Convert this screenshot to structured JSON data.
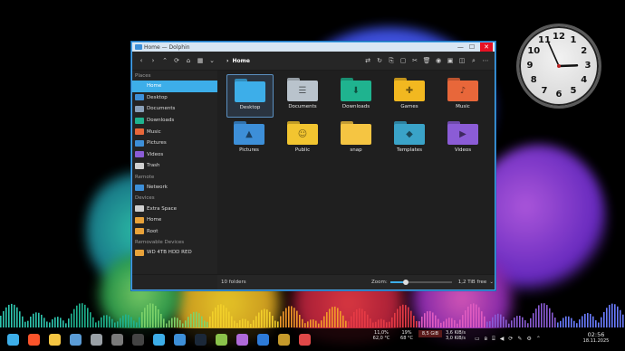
{
  "window": {
    "title": "Home — Dolphin",
    "breadcrumb": "Home",
    "controls": {
      "minimize": "—",
      "maximize": "☐",
      "close": "✕"
    }
  },
  "sidebar": {
    "sections": [
      {
        "header": "Places",
        "items": [
          {
            "label": "Home",
            "icon": "home-icon",
            "color": "#3daee9",
            "active": true
          },
          {
            "label": "Desktop",
            "icon": "desktop-icon",
            "color": "#3d8fd8"
          },
          {
            "label": "Documents",
            "icon": "documents-icon",
            "color": "#8aa0b8"
          },
          {
            "label": "Downloads",
            "icon": "downloads-icon",
            "color": "#1fb38f"
          },
          {
            "label": "Music",
            "icon": "music-icon",
            "color": "#e8673a"
          },
          {
            "label": "Pictures",
            "icon": "pictures-icon",
            "color": "#3d8fd8"
          },
          {
            "label": "Videos",
            "icon": "videos-icon",
            "color": "#8b5cd6"
          },
          {
            "label": "Trash",
            "icon": "trash-icon",
            "color": "#d0d0d0"
          }
        ]
      },
      {
        "header": "Remote",
        "items": [
          {
            "label": "Network",
            "icon": "network-icon",
            "color": "#3d8fd8"
          }
        ]
      },
      {
        "header": "Devices",
        "items": [
          {
            "label": "Extra Space",
            "icon": "drive-icon",
            "color": "#cfcfcf"
          },
          {
            "label": "Home",
            "icon": "hdd-icon",
            "color": "#e8a23a"
          },
          {
            "label": "Root",
            "icon": "hdd-icon",
            "color": "#e8a23a"
          }
        ]
      },
      {
        "header": "Removable Devices",
        "items": [
          {
            "label": "WD 4TB HDD RED",
            "icon": "hdd-icon",
            "color": "#e8a23a"
          }
        ]
      }
    ]
  },
  "folders": [
    {
      "label": "Desktop",
      "color": "#3daee9",
      "glyph": "",
      "selected": true
    },
    {
      "label": "Documents",
      "color": "#b9c3cc",
      "glyph": "☰"
    },
    {
      "label": "Downloads",
      "color": "#1fb38f",
      "glyph": "⬇"
    },
    {
      "label": "Games",
      "color": "#f2b820",
      "glyph": "✚"
    },
    {
      "label": "Music",
      "color": "#e8673a",
      "glyph": "♪"
    },
    {
      "label": "Pictures",
      "color": "#3d8fd8",
      "glyph": "▲"
    },
    {
      "label": "Public",
      "color": "#f2c530",
      "glyph": "☺"
    },
    {
      "label": "snap",
      "color": "#f5c542",
      "glyph": ""
    },
    {
      "label": "Templates",
      "color": "#3aa3c8",
      "glyph": "◆"
    },
    {
      "label": "Videos",
      "color": "#8b5cd6",
      "glyph": "▶"
    }
  ],
  "status": {
    "count": "10 folders",
    "zoom_label": "Zoom:",
    "zoom_level": 0.25,
    "free_space": "1,2 TiB free"
  },
  "clock": {
    "numbers": [
      "12",
      "1",
      "2",
      "3",
      "4",
      "5",
      "6",
      "7",
      "8",
      "9",
      "10",
      "11"
    ],
    "hour": 2,
    "minute": 56
  },
  "taskbar": {
    "cpu": "11,0%",
    "cpu_temp": "62,0 °C",
    "ram": "19%",
    "ram_temp": "68 °C",
    "disk": "8,5 GiB",
    "net_down": "3,6 KiB/s",
    "net_up": "3,0 KiB/s",
    "time": "02:56",
    "date": "18.11.2025",
    "apps": [
      {
        "name": "app-launcher-icon",
        "color": "#3daee9"
      },
      {
        "name": "brave-icon",
        "color": "#fb542b"
      },
      {
        "name": "files-icon",
        "color": "#f5c542"
      },
      {
        "name": "browser-icon",
        "color": "#5a9bd5"
      },
      {
        "name": "settings-icon",
        "color": "#9aa0a6"
      },
      {
        "name": "monitor-icon",
        "color": "#7a7a7a"
      },
      {
        "name": "terminal-icon",
        "color": "#444444"
      },
      {
        "name": "vscode-icon",
        "color": "#3daee9"
      },
      {
        "name": "dolphin-icon",
        "color": "#3d8fd8"
      },
      {
        "name": "steam-icon",
        "color": "#1b2838"
      },
      {
        "name": "layers-icon",
        "color": "#8bc34a"
      },
      {
        "name": "heroic-icon",
        "color": "#b06ad9"
      },
      {
        "name": "code-icon",
        "color": "#2d7bd8"
      },
      {
        "name": "wow-icon",
        "color": "#c59a2b"
      },
      {
        "name": "notes-icon",
        "color": "#e04848"
      }
    ]
  }
}
